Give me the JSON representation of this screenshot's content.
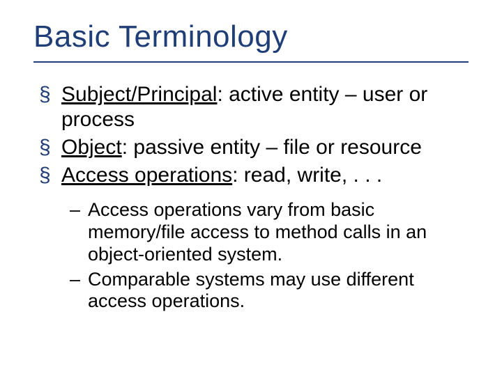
{
  "title": "Basic Terminology",
  "bullets": [
    {
      "term": "Subject/Principal",
      "rest": ": active entity – user or process"
    },
    {
      "term": "Object",
      "rest": ": passive entity – file or resource"
    },
    {
      "term": "Access operations",
      "rest": ": read, write, . . ."
    }
  ],
  "sub": [
    "Access operations vary from basic memory/file access to method calls in an object-oriented system.",
    "Comparable systems may use different access operations."
  ]
}
